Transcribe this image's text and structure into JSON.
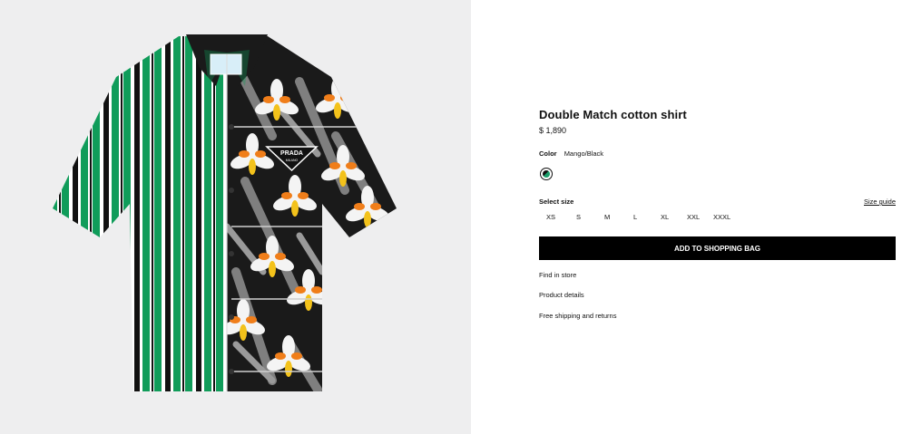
{
  "product": {
    "image_alt": "Striped and iris-print short-sleeve shirt",
    "logo_text": "PRADA",
    "logo_subtext": "MILANO",
    "title": "Double Match cotton shirt",
    "price": "$ 1,890",
    "color_label": "Color",
    "color_value": "Mango/Black",
    "size_label": "Select size",
    "size_guide": "Size guide",
    "sizes": [
      "XS",
      "S",
      "M",
      "L",
      "XL",
      "XXL",
      "XXXL"
    ],
    "add_to_bag": "ADD TO SHOPPING BAG",
    "links": [
      "Find in store",
      "Product details",
      "Free shipping and returns"
    ]
  },
  "colors": {
    "stripe_green": "#109c5a",
    "print_black": "#1a1a1a",
    "petal_white": "#f4f4f4",
    "petal_orange": "#f07e1a",
    "petal_yellow": "#f3c21b",
    "leaf_grey": "#7f7f7f",
    "button_bg": "#000000"
  }
}
